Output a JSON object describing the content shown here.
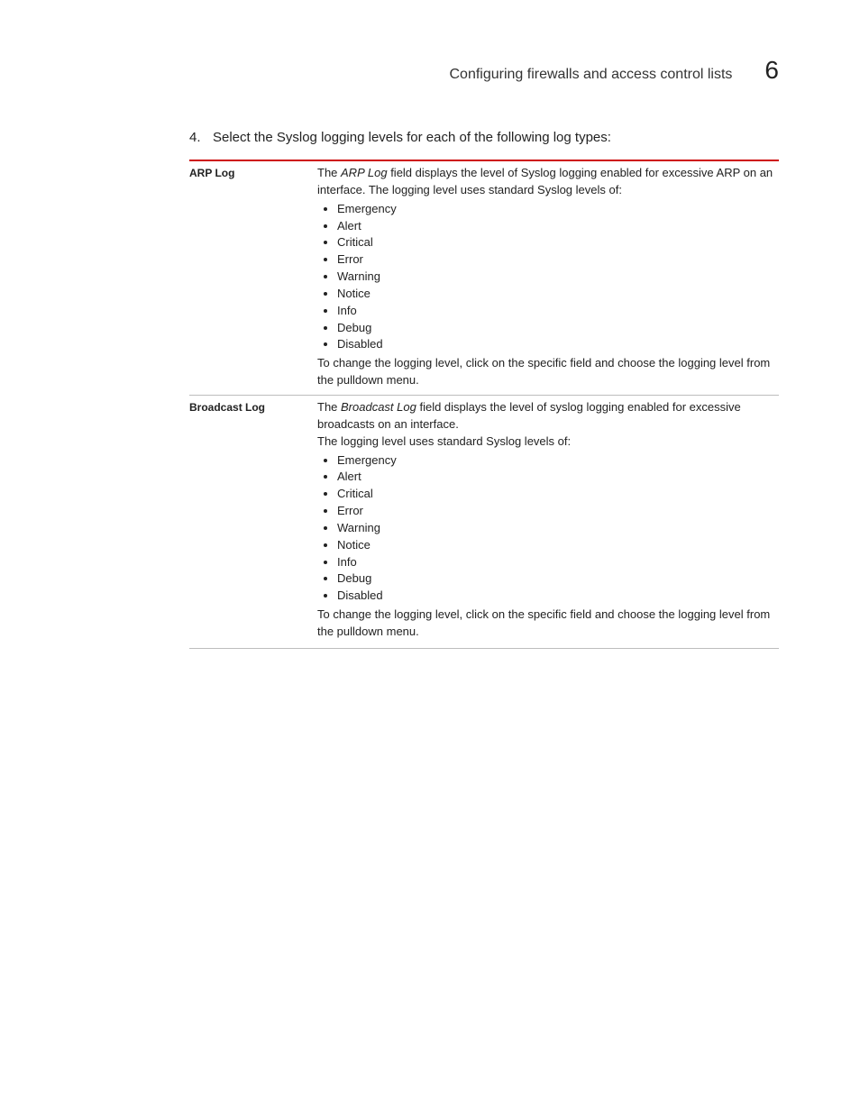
{
  "header": {
    "title": "Configuring firewalls and access control lists",
    "chapter_number": "6"
  },
  "step": {
    "number": "4.",
    "text": "Select the Syslog logging levels for each of the following log types:"
  },
  "rows": [
    {
      "label": "ARP Log",
      "intro_prefix": "The ",
      "fieldname": "ARP Log",
      "intro_suffix": " field displays the level of Syslog logging enabled for excessive ARP on an interface. The logging level uses standard Syslog levels of:",
      "extra_line": "",
      "levels": [
        "Emergency",
        "Alert",
        "Critical",
        "Error",
        "Warning",
        "Notice",
        "Info",
        "Debug",
        "Disabled"
      ],
      "outro": "To change the logging level, click on the specific field and choose the logging level from the pulldown menu."
    },
    {
      "label": "Broadcast Log",
      "intro_prefix": "The ",
      "fieldname": "Broadcast Log",
      "intro_suffix": " field displays the level of syslog logging enabled for excessive broadcasts on an interface.",
      "extra_line": "The logging level uses standard Syslog levels of:",
      "levels": [
        "Emergency",
        "Alert",
        "Critical",
        "Error",
        "Warning",
        "Notice",
        "Info",
        "Debug",
        "Disabled"
      ],
      "outro": "To change the logging level, click on the specific field and choose the logging level from the pulldown menu."
    }
  ]
}
